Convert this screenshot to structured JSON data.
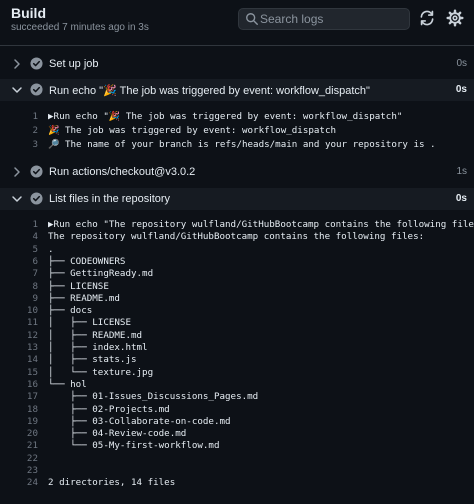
{
  "header": {
    "title": "Build",
    "subtitle": "succeeded 7 minutes ago in 3s",
    "search_placeholder": "Search logs",
    "icons": {
      "search": "search-icon",
      "refresh": "refresh-icon",
      "settings": "gear-icon"
    }
  },
  "colors": {
    "background": "#0d1117",
    "success": "#8b949e",
    "muted": "#8b949e"
  },
  "steps": [
    {
      "name": "Set up job",
      "time": "0s",
      "expanded": false
    },
    {
      "name": "Run echo \"🎉 The job was triggered by event: workflow_dispatch\"",
      "time": "0s",
      "expanded": true
    },
    {
      "name": "Run actions/checkout@v3.0.2",
      "time": "1s",
      "expanded": false
    },
    {
      "name": "List files in the repository",
      "time": "0s",
      "expanded": true
    }
  ],
  "step1_log": [
    {
      "n": "1",
      "t": "▶Run echo \"🎉 The job was triggered by event: workflow_dispatch\""
    },
    {
      "n": "2",
      "t": "🎉 The job was triggered by event: workflow_dispatch"
    },
    {
      "n": "3",
      "t": "🔎 The name of your branch is refs/heads/main and your repository is ."
    }
  ],
  "step3_log": [
    {
      "n": "1",
      "t": "▶Run echo \"The repository wulfland/GitHubBootcamp contains the following files:\""
    },
    {
      "n": "4",
      "t": "The repository wulfland/GitHubBootcamp contains the following files:"
    },
    {
      "n": "5",
      "t": "."
    },
    {
      "n": "6",
      "t": "├── CODEOWNERS"
    },
    {
      "n": "7",
      "t": "├── GettingReady.md"
    },
    {
      "n": "8",
      "t": "├── LICENSE"
    },
    {
      "n": "9",
      "t": "├── README.md"
    },
    {
      "n": "10",
      "t": "├── docs"
    },
    {
      "n": "11",
      "t": "│   ├── LICENSE"
    },
    {
      "n": "12",
      "t": "│   ├── README.md"
    },
    {
      "n": "13",
      "t": "│   ├── index.html"
    },
    {
      "n": "14",
      "t": "│   ├── stats.js"
    },
    {
      "n": "15",
      "t": "│   └── texture.jpg"
    },
    {
      "n": "16",
      "t": "└── hol"
    },
    {
      "n": "17",
      "t": "    ├── 01-Issues_Discussions_Pages.md"
    },
    {
      "n": "18",
      "t": "    ├── 02-Projects.md"
    },
    {
      "n": "19",
      "t": "    ├── 03-Collaborate-on-code.md"
    },
    {
      "n": "20",
      "t": "    ├── 04-Review-code.md"
    },
    {
      "n": "21",
      "t": "    └── 05-My-first-workflow.md"
    },
    {
      "n": "22",
      "t": ""
    },
    {
      "n": "23",
      "t": ""
    },
    {
      "n": "24",
      "t": "2 directories, 14 files"
    }
  ]
}
